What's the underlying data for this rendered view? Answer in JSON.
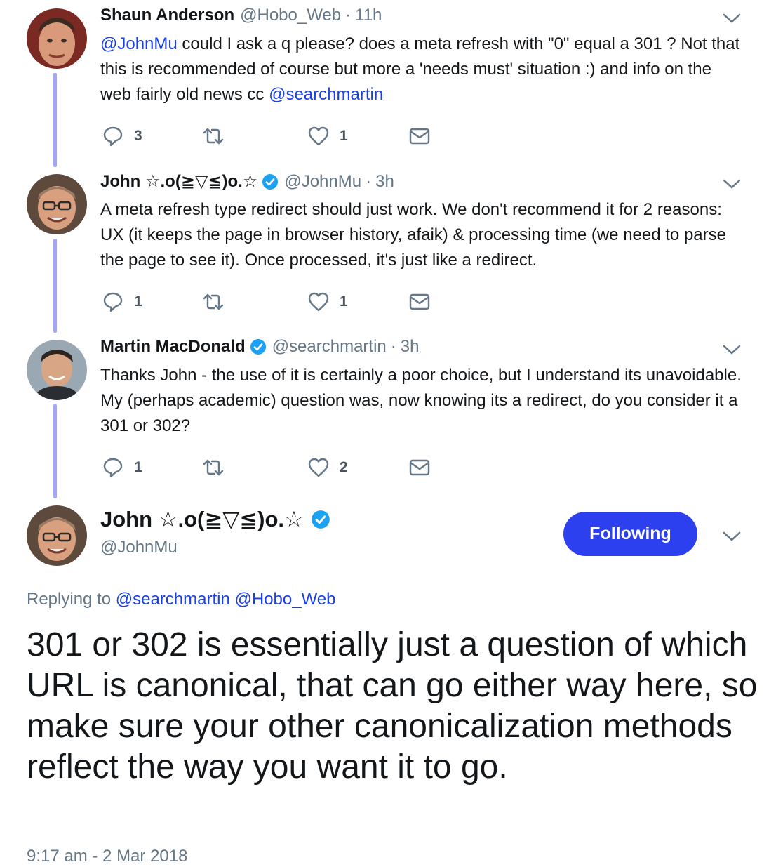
{
  "tweets": [
    {
      "name": "Shaun Anderson",
      "handle": "@Hobo_Web",
      "separator": "·",
      "time": "11h",
      "text_parts": [
        "@JohnMu",
        " could I ask a q please? does a meta refresh with \"0\" equal a 301 ? Not that this is recommended of course but more a 'needs must' situation :) and info on the web fairly old news cc ",
        "@searchmartin"
      ],
      "replies": "3",
      "retweets": "",
      "likes": "1"
    },
    {
      "name": "John ☆.o(≧▽≦)o.☆",
      "handle": "@JohnMu",
      "separator": "·",
      "time": "3h",
      "text": "A meta refresh type redirect should just work. We don't recommend it for 2 reasons: UX (it keeps the page in browser history, afaik) & processing time (we need to parse the page to see it). Once processed, it's just like a redirect.",
      "replies": "1",
      "retweets": "",
      "likes": "1"
    },
    {
      "name": "Martin MacDonald",
      "handle": "@searchmartin",
      "separator": "·",
      "time": "3h",
      "text": "Thanks John - the use of it is certainly a poor choice, but I understand its unavoidable.  My (perhaps academic) question was, now knowing its a redirect, do you consider it a 301 or 302?",
      "replies": "1",
      "retweets": "",
      "likes": "2"
    }
  ],
  "main_tweet": {
    "name": "John ☆.o(≧▽≦)o.☆",
    "handle": "@JohnMu",
    "follow_label": "Following",
    "replying_prefix": "Replying to",
    "replying_to": [
      "@searchmartin",
      "@Hobo_Web"
    ],
    "text": "301 or 302 is essentially just a question of which URL is canonical, that can go either way here, so make sure your other canonicalization methods reflect the way you want it to go.",
    "timestamp": "9:17 am - 2 Mar 2018"
  },
  "icons": [
    "reply-icon",
    "retweet-icon",
    "like-icon",
    "direct-message-icon",
    "verified-badge-icon",
    "chevron-down-icon"
  ],
  "colors": {
    "link": "#1a40e6",
    "thread_line": "#a3a6f5",
    "follow_button": "#2c40f0",
    "verified": "#1da1f2",
    "muted": "#657786"
  }
}
